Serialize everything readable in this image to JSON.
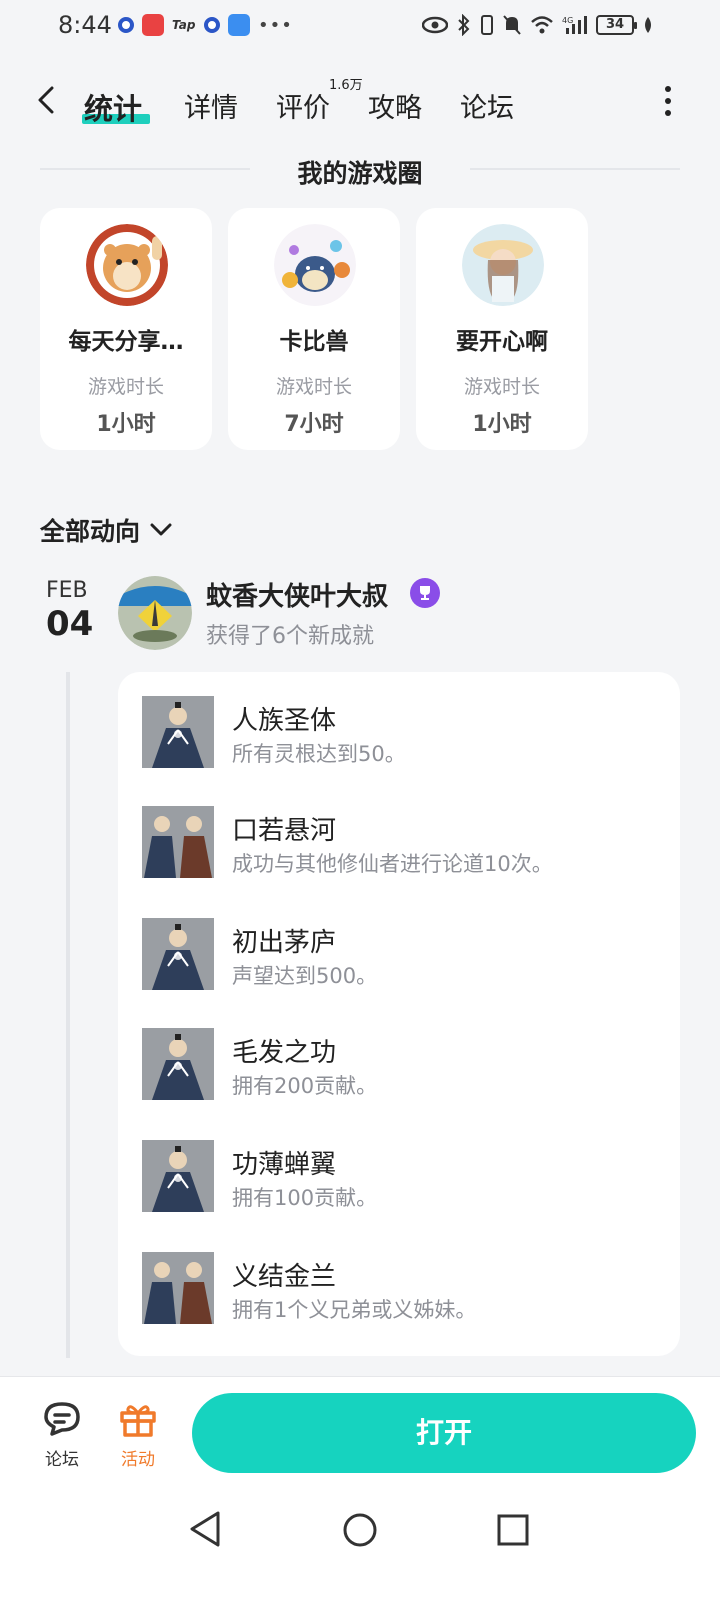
{
  "status_bar": {
    "time": "8:44",
    "battery": "34",
    "tap_label": "Tap",
    "network": "4G"
  },
  "nav": {
    "tabs": [
      {
        "label": "统计",
        "active": true
      },
      {
        "label": "详情"
      },
      {
        "label": "评价",
        "badge": "1.6万"
      },
      {
        "label": "攻略"
      },
      {
        "label": "论坛"
      }
    ]
  },
  "game_circle": {
    "title": "我的游戏圈",
    "members": [
      {
        "name": "每天分享…",
        "label": "游戏时长",
        "value": "1小时"
      },
      {
        "name": "卡比兽",
        "label": "游戏时长",
        "value": "7小时"
      },
      {
        "name": "要开心啊",
        "label": "游戏时长",
        "value": "1小时"
      }
    ]
  },
  "feed": {
    "filter_label": "全部动向",
    "post": {
      "month": "FEB",
      "day": "04",
      "user": "蚊香大侠叶大叔",
      "summary": "获得了6个新成就",
      "achievements": [
        {
          "title": "人族圣体",
          "desc": "所有灵根达到50。"
        },
        {
          "title": "口若悬河",
          "desc": "成功与其他修仙者进行论道10次。"
        },
        {
          "title": "初出茅庐",
          "desc": "声望达到500。"
        },
        {
          "title": "毛发之功",
          "desc": "拥有200贡献。"
        },
        {
          "title": "功薄蝉翼",
          "desc": "拥有100贡献。"
        },
        {
          "title": "义结金兰",
          "desc": "拥有1个义兄弟或义姊妹。"
        }
      ]
    }
  },
  "bottom_bar": {
    "forum_label": "论坛",
    "activity_label": "活动",
    "open_label": "打开"
  },
  "colors": {
    "accent": "#16d3bf",
    "activity": "#f07a2b",
    "badge": "#8a4de8"
  }
}
